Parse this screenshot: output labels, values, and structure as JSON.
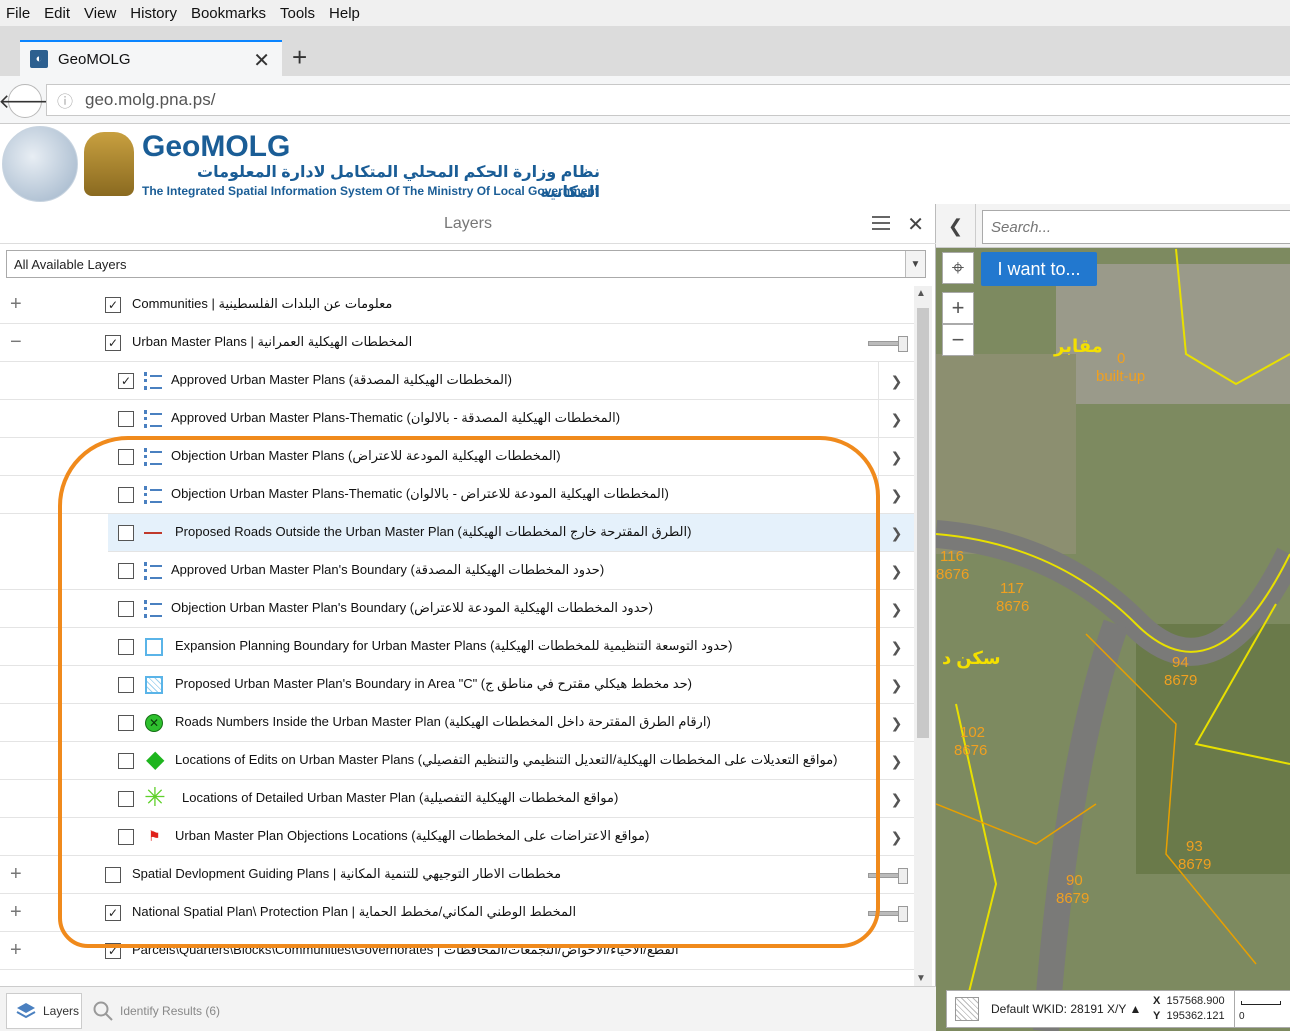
{
  "browser": {
    "menu": [
      "File",
      "Edit",
      "View",
      "History",
      "Bookmarks",
      "Tools",
      "Help"
    ],
    "tab_title": "GeoMOLG",
    "new_tab": "+",
    "url_host": "geo.molg.pna.ps/"
  },
  "header": {
    "brand": "GeoMOLG",
    "arabic": "نظام وزارة الحكم المحلي المتكامل لادارة المعلومات المكانية",
    "english": "The Integrated Spatial Information System Of The Ministry Of Local Government"
  },
  "layers": {
    "title": "Layers",
    "filter": "All Available Layers",
    "groups_top": [
      {
        "label": "Communities | معلومات عن البلدات الفلسطينية",
        "checked": true,
        "expander": "+"
      },
      {
        "label": "Urban Master Plans | المخططات الهيكلية العمرانية",
        "checked": true,
        "expander": "−"
      }
    ],
    "sublayers": [
      {
        "label": "Approved Urban Master Plans (المخططات الهيكلية المصدقة)",
        "checked": true,
        "legend": "list-icon"
      },
      {
        "label": "Approved Urban Master Plans-Thematic (المخططات الهيكلية المصدقة - بالالوان)",
        "checked": false,
        "legend": "list-icon"
      },
      {
        "label": "Objection Urban Master Plans (المخططات الهيكلية المودعة للاعتراض)",
        "checked": false,
        "legend": "list-icon"
      },
      {
        "label": "Objection Urban Master Plans-Thematic (المخططات الهيكلية المودعة للاعتراض - بالالوان)",
        "checked": false,
        "legend": "list-icon"
      },
      {
        "label": "Proposed Roads Outside the Urban Master Plan (الطرق المقترحة خارج المخططات الهيكلية)",
        "checked": false,
        "legend": "red-line-icon"
      },
      {
        "label": "Approved Urban Master Plan's Boundary (حدود المخططات الهيكلية المصدقة)",
        "checked": false,
        "legend": "list-icon"
      },
      {
        "label": "Objection Urban Master Plan's Boundary (حدود المخططات الهيكلية المودعة للاعتراض)",
        "checked": false,
        "legend": "list-icon"
      },
      {
        "label": "Expansion Planning Boundary for Urban Master Plans (حدود التوسعة التنظيمية للمخططات الهيكلية)",
        "checked": false,
        "legend": "blue-square-icon"
      },
      {
        "label": "Proposed Urban Master Plan's Boundary in Area \"C\" (حد مخطط هيكلي مقترح في مناطق ج)",
        "checked": false,
        "legend": "hatched-square-icon"
      },
      {
        "label": "Roads Numbers Inside the Urban Master Plan (ارقام الطرق المقترحة داخل المخططات الهيكلية)",
        "checked": false,
        "legend": "green-x-circle-icon"
      },
      {
        "label": "Locations of Edits on Urban Master Plans (مواقع التعديلات على المخططات الهيكلية/التعديل التنظيمي والتنظيم التفصيلي)",
        "checked": false,
        "legend": "green-diamond-icon"
      },
      {
        "label": "Locations of Detailed Urban Master Plan (مواقع المخططات الهيكلية التفصيلية)",
        "checked": false,
        "legend": "green-star-icon"
      },
      {
        "label": "Urban Master Plan Objections Locations (مواقع الاعتراضات على المخططات الهيكلية)",
        "checked": false,
        "legend": "red-flag-icon"
      }
    ],
    "groups_bottom": [
      {
        "label": "Spatial Devlopment Guiding Plans | مخططات الاطار التوجيهي للتنمية المكانية",
        "checked": false,
        "expander": "+"
      },
      {
        "label": "National Spatial Plan\\ Protection Plan | المخطط الوطني المكاني/مخطط الحماية",
        "checked": true,
        "expander": "+"
      },
      {
        "label": "Parcels\\Quarters\\Blocks\\Communities\\Governorates | القطع/الاحياء/الاحواض/التجمعات/المحافظات",
        "checked": true,
        "expander": "+"
      }
    ],
    "bottom_tabs": {
      "layers": "Layers",
      "identify": "Identify Results (6)"
    }
  },
  "map": {
    "search_placeholder": "Search...",
    "i_want_to": "I want to...",
    "labels": [
      "مقابر",
      "0",
      "built-up",
      "116",
      "8676",
      "117",
      "8676",
      "سكن د",
      "94",
      "8679",
      "102",
      "8676",
      "93",
      "8679",
      "90",
      "8679"
    ],
    "wkid": "Default WKID: 28191 X/Y ▲",
    "x_label": "X",
    "x_value": "157568.900",
    "y_label": "Y",
    "y_value": "195362.121",
    "scale_zero": "0"
  },
  "colors": {
    "accent": "#2278cf",
    "annotation": "#f08a1c",
    "brand": "#1a5d96"
  }
}
